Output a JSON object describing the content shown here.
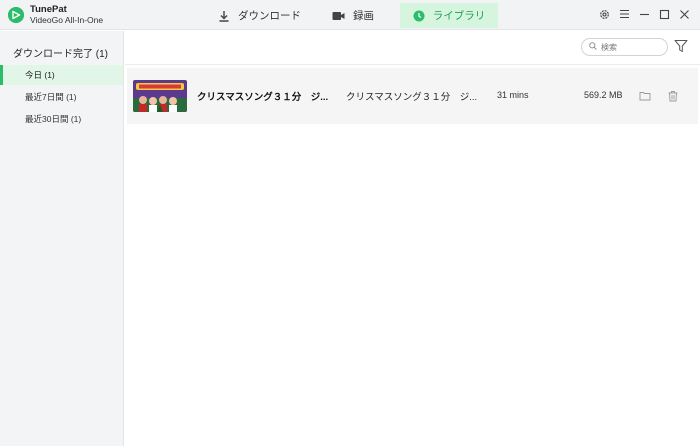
{
  "app": {
    "name": "TunePat",
    "subtitle": "VideoGo All-In-One"
  },
  "tabs": [
    {
      "label": "ダウンロード",
      "icon": "download-icon"
    },
    {
      "label": "録画",
      "icon": "video-camera-icon"
    },
    {
      "label": "ライブラリ",
      "icon": "clock-icon",
      "active": true
    }
  ],
  "window_controls": [
    "settings-icon",
    "menu-icon",
    "minimize-icon",
    "maximize-icon",
    "close-icon"
  ],
  "sidebar": {
    "heading": "ダウンロード完了 (1)",
    "items": [
      {
        "label": "今日 (1)",
        "active": true
      },
      {
        "label": "最近7日間 (1)"
      },
      {
        "label": "最近30日間 (1)"
      }
    ]
  },
  "search": {
    "placeholder": "検索"
  },
  "library": {
    "rows": [
      {
        "title": "クリスマスソング３１分　ジ...",
        "album": "クリスマスソング３１分　ジ...",
        "duration": "31 mins",
        "size": "569.2 MB"
      }
    ]
  },
  "colors": {
    "accent": "#2cbd6b",
    "active_tab_bg": "#d6f5df",
    "sidebar_bg": "#f3f4f6",
    "row_bg": "#f5f5f6"
  }
}
